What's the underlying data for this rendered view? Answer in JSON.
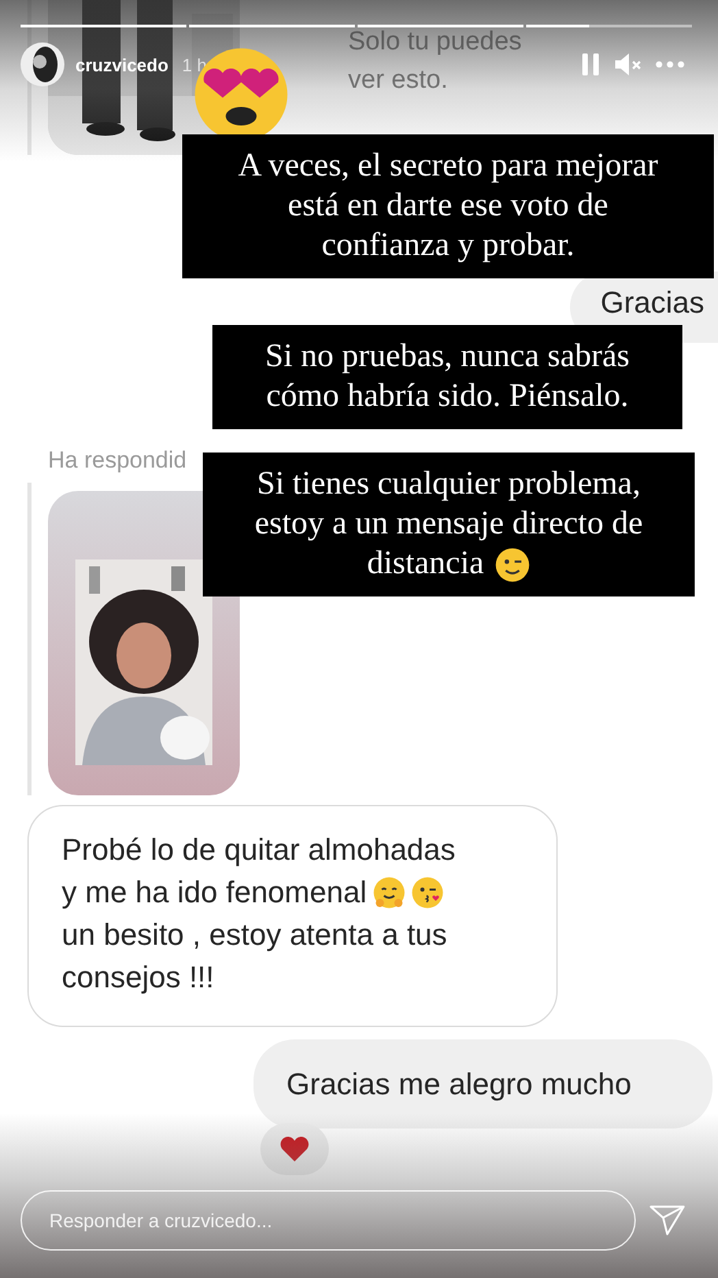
{
  "progress": [
    {
      "level": 1
    },
    {
      "level": 1
    },
    {
      "level": 1
    },
    {
      "level": 0.38
    }
  ],
  "header": {
    "username": "cruzvicedo",
    "time": "1 h"
  },
  "chat": {
    "private_note": [
      "Solo tu puedes",
      "ver esto."
    ],
    "sent_partial": "Gracias",
    "reply_note": "Ha respondid",
    "received": [
      {
        "text": "Probé lo de quitar almohadas"
      },
      {
        "text": "y me ha ido fenomenal",
        "emoji": [
          {
            "kind": "hug"
          },
          {
            "kind": "kiss"
          }
        ]
      },
      {
        "text": "un besito , estoy atenta a tus"
      },
      {
        "text": "consejos !!!"
      }
    ],
    "sent": "Gracias me alegro mucho"
  },
  "captions": [
    {
      "lines": [
        "A veces, el secreto para mejorar",
        "está en darte ese voto de",
        "confianza y probar."
      ]
    },
    {
      "lines": [
        "Si no pruebas, nunca sabrás",
        "cómo habría sido. Piénsalo."
      ]
    },
    {
      "lines": [
        "Si tienes cualquier problema,",
        "estoy a un mensaje directo de",
        "distancia"
      ],
      "emoji": {
        "kind": "wink"
      }
    }
  ],
  "reply_field": {
    "placeholder": "Responder a cruzvicedo..."
  }
}
